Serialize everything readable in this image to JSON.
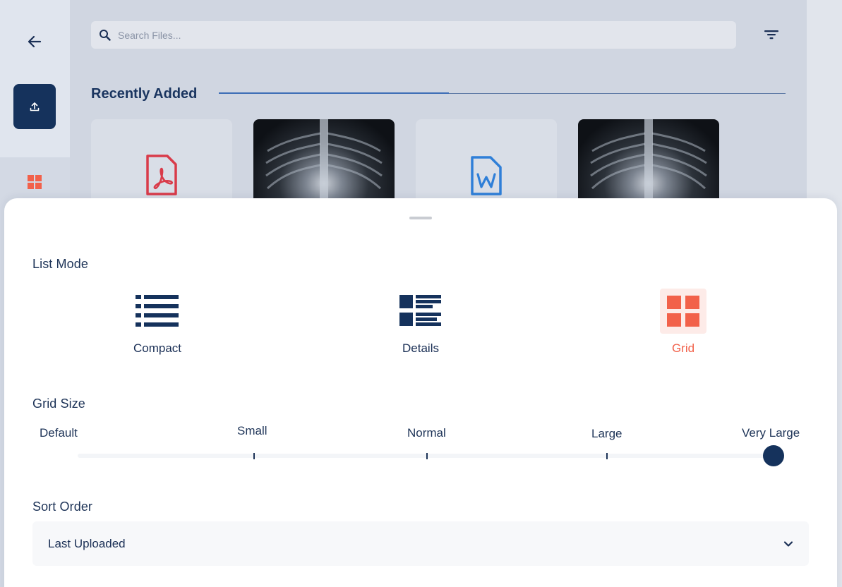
{
  "search": {
    "placeholder": "Search Files..."
  },
  "section": {
    "title": "Recently Added"
  },
  "cards": [
    {
      "type": "pdf"
    },
    {
      "type": "image"
    },
    {
      "type": "word"
    },
    {
      "type": "image"
    }
  ],
  "sheet": {
    "list_mode": {
      "title": "List Mode",
      "options": [
        {
          "label": "Compact",
          "icon": "compact-list-icon"
        },
        {
          "label": "Details",
          "icon": "details-list-icon"
        },
        {
          "label": "Grid",
          "icon": "grid-view-icon"
        }
      ],
      "selected": "Grid"
    },
    "grid_size": {
      "title": "Grid Size",
      "stops": [
        "Default",
        "Small",
        "Normal",
        "Large",
        "Very Large"
      ],
      "selected": "Very Large"
    },
    "sort_order": {
      "title": "Sort Order",
      "value": "Last Uploaded"
    }
  },
  "colors": {
    "primary": "#15325c",
    "accent": "#f2614a",
    "pdf": "#d93b4a",
    "word": "#2f7fd8"
  }
}
